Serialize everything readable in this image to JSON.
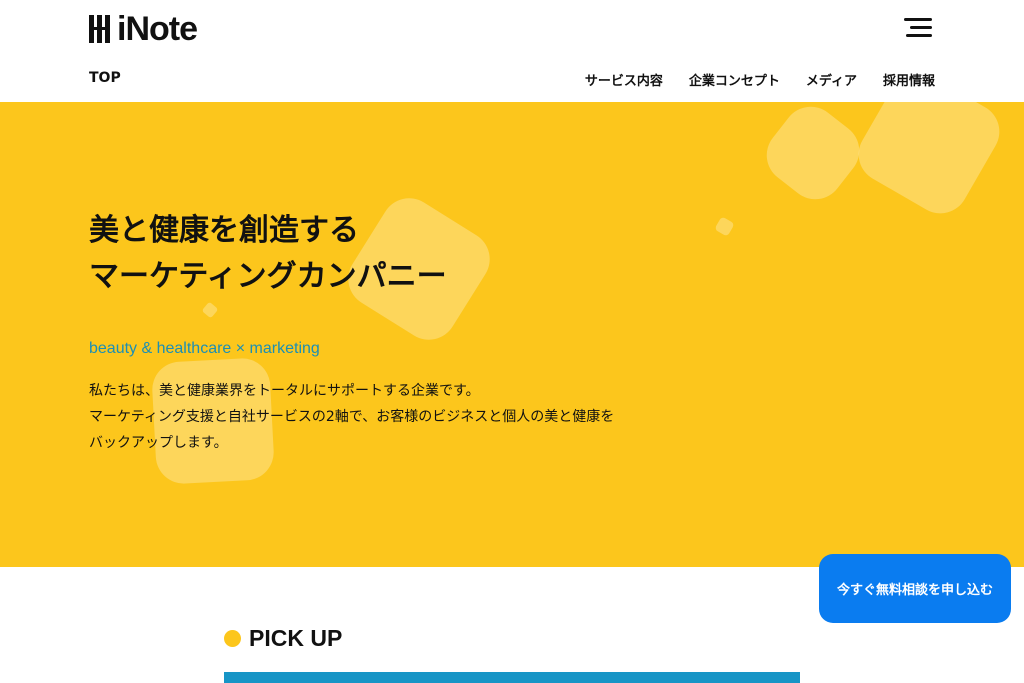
{
  "header": {
    "logo_text": "iNote",
    "nav_top": "TOP",
    "nav": [
      "サービス内容",
      "企業コンセプト",
      "メディア",
      "採用情報"
    ]
  },
  "hero": {
    "title_line1": "美と健康を創造する",
    "title_line2": "マーケティングカンパニー",
    "subtitle": "beauty & healthcare × marketing",
    "body_line1": "私たちは、美と健康業界をトータルにサポートする企業です。",
    "body_line2": "マーケティング支援と自社サービスの2軸で、お客様のビジネスと個人の美と健康を",
    "body_line3": "バックアップします。"
  },
  "pickup": {
    "title": "PICK UP"
  },
  "cta": {
    "label": "今すぐ無料相談を申し込む"
  },
  "colors": {
    "hero_bg": "#fcc61c",
    "subtitle": "#1b8fb5",
    "cta_bg": "#0a7cf0",
    "banner": "#1795c6"
  }
}
